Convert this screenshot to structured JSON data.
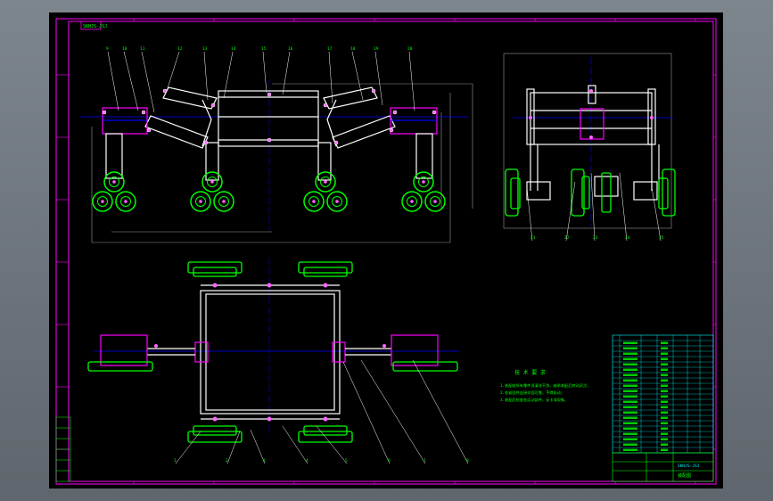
{
  "title_block": {
    "drawing_number": "SKHJS-JSJ",
    "drawing_name": "装配图",
    "corner_label": "SKHJS-JSJ"
  },
  "tech_notes": {
    "heading": "技 术 要 求",
    "lines": [
      "1.装配前所有零件须清洗干净，轴承装配后转动灵活；",
      "2.各紧固件连接牢固可靠，不得松动；",
      "3.装配后检查各运动部件，无卡滞现象。"
    ]
  },
  "balloons": {
    "top_view": [
      "9",
      "10",
      "11",
      "12",
      "13",
      "14",
      "15",
      "16",
      "17",
      "18",
      "19",
      "20"
    ],
    "side_view": [
      "21",
      "22",
      "23",
      "24",
      "25"
    ],
    "plan_view": [
      "1",
      "2",
      "3",
      "4",
      "5",
      "6",
      "7",
      "8"
    ]
  },
  "colors": {
    "frame": "#ff00ff",
    "part": "#ffffff",
    "wheel": "#00ff00",
    "centerline": "#0000ff",
    "dimension": "#9a9a9a",
    "leader": "#ffffff",
    "table": "#00ffff"
  }
}
